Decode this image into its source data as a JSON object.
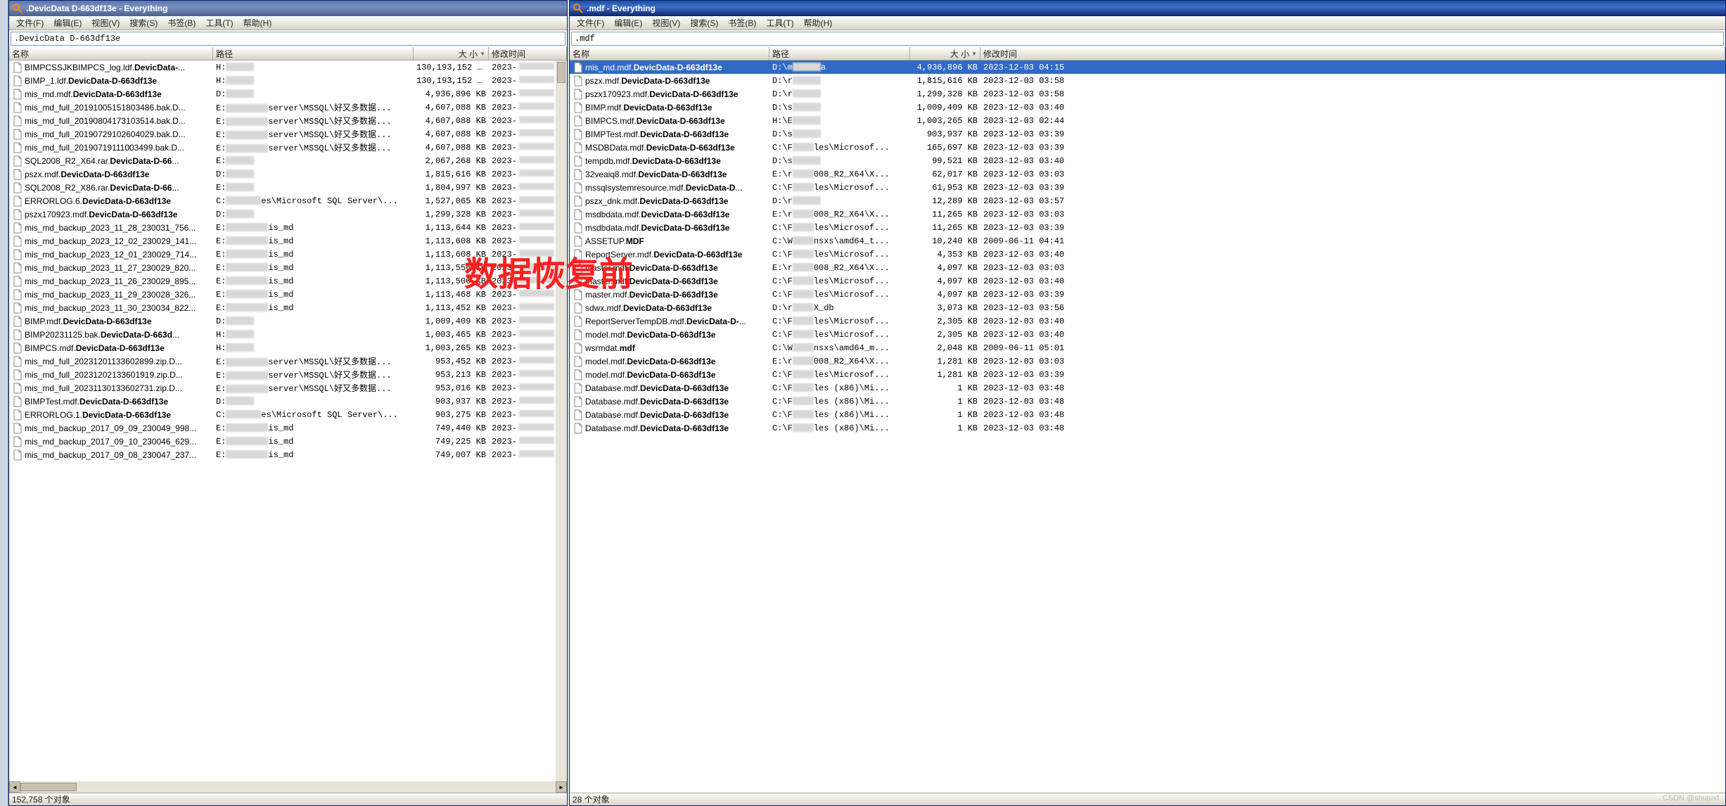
{
  "overlay": "数据恢复前",
  "watermark": "CSDN @shujuxf",
  "windows": [
    {
      "title": ".DevicData D-663df13e - Everything",
      "active": false,
      "menu": [
        "文件(F)",
        "编辑(E)",
        "视图(V)",
        "搜索(S)",
        "书签(B)",
        "工具(T)",
        "帮助(H)"
      ],
      "search": ".DevicData D-663df13e",
      "columns": {
        "name": "名称",
        "path": "路径",
        "size": "大 小",
        "date": "修改时间"
      },
      "status": "152,758 个对象",
      "rows": [
        {
          "name": "BIMPCSSJKBIMPCS_log.ldf.DevicData-...",
          "sel": false,
          "path_pre": "H:",
          "path_mid": 40,
          "path_post": "",
          "size": "130,193,152 KB",
          "date": "2023-"
        },
        {
          "name": "BIMP_1.ldf.DevicData-D-663df13e",
          "sel": false,
          "path_pre": "H:",
          "path_mid": 40,
          "path_post": "",
          "size": "130,193,152 KB",
          "date": "2023-"
        },
        {
          "name": "mis_md.mdf.DevicData-D-663df13e",
          "sel": false,
          "path_pre": "D:",
          "path_mid": 40,
          "path_post": "",
          "size": "4,936,896 KB",
          "date": "2023-"
        },
        {
          "name": "mis_md_full_20191005151803486.bak.D...",
          "sel": false,
          "path_pre": "E:",
          "path_mid": 60,
          "path_post": "server\\MSSQL\\好又多数据...",
          "size": "4,607,088 KB",
          "date": "2023-"
        },
        {
          "name": "mis_md_full_20190804173103514.bak.D...",
          "sel": false,
          "path_pre": "E:",
          "path_mid": 60,
          "path_post": "server\\MSSQL\\好又多数据...",
          "size": "4,607,088 KB",
          "date": "2023-"
        },
        {
          "name": "mis_md_full_20190729102604029.bak.D...",
          "sel": false,
          "path_pre": "E:",
          "path_mid": 60,
          "path_post": "server\\MSSQL\\好又多数据...",
          "size": "4,607,088 KB",
          "date": "2023-"
        },
        {
          "name": "mis_md_full_20190719111003499.bak.D...",
          "sel": false,
          "path_pre": "E:",
          "path_mid": 60,
          "path_post": "server\\MSSQL\\好又多数据...",
          "size": "4,607,088 KB",
          "date": "2023-"
        },
        {
          "name": "SQL2008_R2_X64.rar.DevicData-D-66...",
          "sel": false,
          "path_pre": "E:",
          "path_mid": 40,
          "path_post": "",
          "size": "2,067,268 KB",
          "date": "2023-"
        },
        {
          "name": "pszx.mdf.DevicData-D-663df13e",
          "sel": false,
          "path_pre": "D:",
          "path_mid": 40,
          "path_post": "",
          "size": "1,815,616 KB",
          "date": "2023-"
        },
        {
          "name": "SQL2008_R2_X86.rar.DevicData-D-66...",
          "sel": false,
          "path_pre": "E:",
          "path_mid": 40,
          "path_post": "",
          "size": "1,804,997 KB",
          "date": "2023-"
        },
        {
          "name": "ERRORLOG.6.DevicData-D-663df13e",
          "sel": false,
          "path_pre": "C:",
          "path_mid": 50,
          "path_post": "es\\Microsoft SQL Server\\...",
          "size": "1,527,065 KB",
          "date": "2023-"
        },
        {
          "name": "pszx170923.mdf.DevicData-D-663df13e",
          "sel": false,
          "path_pre": "D:",
          "path_mid": 40,
          "path_post": "",
          "size": "1,299,328 KB",
          "date": "2023-"
        },
        {
          "name": "mis_md_backup_2023_11_28_230031_756...",
          "sel": false,
          "path_pre": "E:",
          "path_mid": 60,
          "path_post": "is_md",
          "size": "1,113,644 KB",
          "date": "2023-"
        },
        {
          "name": "mis_md_backup_2023_12_02_230029_141...",
          "sel": false,
          "path_pre": "E:",
          "path_mid": 60,
          "path_post": "is_md",
          "size": "1,113,608 KB",
          "date": "2023-"
        },
        {
          "name": "mis_md_backup_2023_12_01_230029_714...",
          "sel": false,
          "path_pre": "E:",
          "path_mid": 60,
          "path_post": "is_md",
          "size": "1,113,608 KB",
          "date": "2023-"
        },
        {
          "name": "mis_md_backup_2023_11_27_230029_820...",
          "sel": false,
          "path_pre": "E:",
          "path_mid": 60,
          "path_post": "is_md",
          "size": "1,113,556 KB",
          "date": "2023-"
        },
        {
          "name": "mis_md_backup_2023_11_26_230029_895...",
          "sel": false,
          "path_pre": "E:",
          "path_mid": 60,
          "path_post": "is_md",
          "size": "1,113,500 KB",
          "date": "2023-"
        },
        {
          "name": "mis_md_backup_2023_11_29_230028_326...",
          "sel": false,
          "path_pre": "E:",
          "path_mid": 60,
          "path_post": "is_md",
          "size": "1,113,468 KB",
          "date": "2023-"
        },
        {
          "name": "mis_md_backup_2023_11_30_230034_822...",
          "sel": false,
          "path_pre": "E:",
          "path_mid": 60,
          "path_post": "is_md",
          "size": "1,113,452 KB",
          "date": "2023-"
        },
        {
          "name": "BIMP.mdf.DevicData-D-663df13e",
          "sel": false,
          "path_pre": "D:",
          "path_mid": 40,
          "path_post": "",
          "size": "1,009,409 KB",
          "date": "2023-"
        },
        {
          "name": "BIMP20231125.bak.DevicData-D-663d...",
          "sel": false,
          "path_pre": "H:",
          "path_mid": 40,
          "path_post": "",
          "size": "1,003,465 KB",
          "date": "2023-"
        },
        {
          "name": "BIMPCS.mdf.DevicData-D-663df13e",
          "sel": false,
          "path_pre": "H:",
          "path_mid": 40,
          "path_post": "",
          "size": "1,003,265 KB",
          "date": "2023-"
        },
        {
          "name": "mis_md_full_20231201133602899.zip.D...",
          "sel": false,
          "path_pre": "E:",
          "path_mid": 60,
          "path_post": "server\\MSSQL\\好又多数据...",
          "size": "953,452 KB",
          "date": "2023-"
        },
        {
          "name": "mis_md_full_20231202133601919.zip.D...",
          "sel": false,
          "path_pre": "E:",
          "path_mid": 60,
          "path_post": "server\\MSSQL\\好又多数据...",
          "size": "953,213 KB",
          "date": "2023-"
        },
        {
          "name": "mis_md_full_20231130133602731.zip.D...",
          "sel": false,
          "path_pre": "E:",
          "path_mid": 60,
          "path_post": "server\\MSSQL\\好又多数据...",
          "size": "953,016 KB",
          "date": "2023-"
        },
        {
          "name": "BIMPTest.mdf.DevicData-D-663df13e",
          "sel": false,
          "path_pre": "D:",
          "path_mid": 40,
          "path_post": "",
          "size": "903,937 KB",
          "date": "2023-"
        },
        {
          "name": "ERRORLOG.1.DevicData-D-663df13e",
          "sel": false,
          "path_pre": "C:",
          "path_mid": 50,
          "path_post": "es\\Microsoft SQL Server\\...",
          "size": "903,275 KB",
          "date": "2023-"
        },
        {
          "name": "mis_md_backup_2017_09_09_230049_998...",
          "sel": false,
          "path_pre": "E:",
          "path_mid": 60,
          "path_post": "is_md",
          "size": "749,440 KB",
          "date": "2023-"
        },
        {
          "name": "mis_md_backup_2017_09_10_230046_629...",
          "sel": false,
          "path_pre": "E:",
          "path_mid": 60,
          "path_post": "is_md",
          "size": "749,225 KB",
          "date": "2023-"
        },
        {
          "name": "mis_md_backup_2017_09_08_230047_237...",
          "sel": false,
          "path_pre": "E:",
          "path_mid": 60,
          "path_post": "is_md",
          "size": "749,007 KB",
          "date": "2023-"
        }
      ]
    },
    {
      "title": ".mdf - Everything",
      "active": true,
      "menu": [
        "文件(F)",
        "编辑(E)",
        "视图(V)",
        "搜索(S)",
        "书签(B)",
        "工具(T)",
        "帮助(H)"
      ],
      "search": ".mdf",
      "columns": {
        "name": "名称",
        "path": "路径",
        "size": "大 小",
        "date": "修改时间"
      },
      "status": "28 个对象",
      "rows": [
        {
          "name": "mis_md.mdf.DevicData-D-663df13e",
          "sel": true,
          "path_pre": "D:\\m",
          "path_mid": 40,
          "path_post": "a",
          "size": "4,936,896 KB",
          "date": "2023-12-03 04:15"
        },
        {
          "name": "pszx.mdf.DevicData-D-663df13e",
          "sel": false,
          "path_pre": "D:\\r",
          "path_mid": 40,
          "path_post": "",
          "size": "1,815,616 KB",
          "date": "2023-12-03 03:58"
        },
        {
          "name": "pszx170923.mdf.DevicData-D-663df13e",
          "sel": false,
          "path_pre": "D:\\r",
          "path_mid": 40,
          "path_post": "",
          "size": "1,299,328 KB",
          "date": "2023-12-03 03:58"
        },
        {
          "name": "BIMP.mdf.DevicData-D-663df13e",
          "sel": false,
          "path_pre": "D:\\s",
          "path_mid": 40,
          "path_post": "",
          "size": "1,009,409 KB",
          "date": "2023-12-03 03:40"
        },
        {
          "name": "BIMPCS.mdf.DevicData-D-663df13e",
          "sel": false,
          "path_pre": "H:\\E",
          "path_mid": 40,
          "path_post": "",
          "size": "1,003,265 KB",
          "date": "2023-12-03 02:44"
        },
        {
          "name": "BIMPTest.mdf.DevicData-D-663df13e",
          "sel": false,
          "path_pre": "D:\\s",
          "path_mid": 40,
          "path_post": "",
          "size": "903,937 KB",
          "date": "2023-12-03 03:39"
        },
        {
          "name": "MSDBData.mdf.DevicData-D-663df13e",
          "sel": false,
          "path_pre": "C:\\F",
          "path_mid": 30,
          "path_post": "les\\Microsof...",
          "size": "165,697 KB",
          "date": "2023-12-03 03:39"
        },
        {
          "name": "tempdb.mdf.DevicData-D-663df13e",
          "sel": false,
          "path_pre": "D:\\s",
          "path_mid": 40,
          "path_post": "",
          "size": "99,521 KB",
          "date": "2023-12-03 03:40"
        },
        {
          "name": "32veaiq8.mdf.DevicData-D-663df13e",
          "sel": false,
          "path_pre": "E:\\r",
          "path_mid": 30,
          "path_post": "008_R2_X64\\X...",
          "size": "62,017 KB",
          "date": "2023-12-03 03:03"
        },
        {
          "name": "mssqlsystemresource.mdf.DevicData-D...",
          "sel": false,
          "path_pre": "C:\\F",
          "path_mid": 30,
          "path_post": "les\\Microsof...",
          "size": "61,953 KB",
          "date": "2023-12-03 03:39"
        },
        {
          "name": "pszx_dnk.mdf.DevicData-D-663df13e",
          "sel": false,
          "path_pre": "D:\\r",
          "path_mid": 40,
          "path_post": "",
          "size": "12,289 KB",
          "date": "2023-12-03 03:57"
        },
        {
          "name": "msdbdata.mdf.DevicData-D-663df13e",
          "sel": false,
          "path_pre": "E:\\r",
          "path_mid": 30,
          "path_post": "008_R2_X64\\X...",
          "size": "11,265 KB",
          "date": "2023-12-03 03:03"
        },
        {
          "name": "msdbdata.mdf.DevicData-D-663df13e",
          "sel": false,
          "path_pre": "C:\\F",
          "path_mid": 30,
          "path_post": "les\\Microsof...",
          "size": "11,265 KB",
          "date": "2023-12-03 03:39"
        },
        {
          "name": "ASSETUP.MDF",
          "sel": false,
          "strong": true,
          "path_pre": "C:\\W",
          "path_mid": 30,
          "path_post": "nsxs\\amd64_t...",
          "size": "10,240 KB",
          "date": "2009-06-11 04:41"
        },
        {
          "name": "ReportServer.mdf.DevicData-D-663df13e",
          "sel": false,
          "path_pre": "C:\\F",
          "path_mid": 30,
          "path_post": "les\\Microsof...",
          "size": "4,353 KB",
          "date": "2023-12-03 03:40"
        },
        {
          "name": "master.mdf.DevicData-D-663df13e",
          "sel": false,
          "path_pre": "E:\\r",
          "path_mid": 30,
          "path_post": "008_R2_X64\\X...",
          "size": "4,097 KB",
          "date": "2023-12-03 03:03"
        },
        {
          "name": "master.mdf.DevicData-D-663df13e",
          "sel": false,
          "path_pre": "C:\\F",
          "path_mid": 30,
          "path_post": "les\\Microsof...",
          "size": "4,097 KB",
          "date": "2023-12-03 03:40"
        },
        {
          "name": "master.mdf.DevicData-D-663df13e",
          "sel": false,
          "path_pre": "C:\\F",
          "path_mid": 30,
          "path_post": "les\\Microsof...",
          "size": "4,097 KB",
          "date": "2023-12-03 03:39"
        },
        {
          "name": "sdwx.mdf.DevicData-D-663df13e",
          "sel": false,
          "path_pre": "D:\\r",
          "path_mid": 30,
          "path_post": "X_db",
          "size": "3,073 KB",
          "date": "2023-12-03 03:56"
        },
        {
          "name": "ReportServerTempDB.mdf.DevicData-D-...",
          "sel": false,
          "path_pre": "C:\\F",
          "path_mid": 30,
          "path_post": "les\\Microsof...",
          "size": "2,305 KB",
          "date": "2023-12-03 03:40"
        },
        {
          "name": "model.mdf.DevicData-D-663df13e",
          "sel": false,
          "path_pre": "C:\\F",
          "path_mid": 30,
          "path_post": "les\\Microsof...",
          "size": "2,305 KB",
          "date": "2023-12-03 03:40"
        },
        {
          "name": "wsrmdat.mdf",
          "sel": false,
          "strong": true,
          "path_pre": "C:\\W",
          "path_mid": 30,
          "path_post": "nsxs\\amd64_m...",
          "size": "2,048 KB",
          "date": "2009-06-11 05:01"
        },
        {
          "name": "model.mdf.DevicData-D-663df13e",
          "sel": false,
          "path_pre": "E:\\r",
          "path_mid": 30,
          "path_post": "008_R2_X64\\X...",
          "size": "1,281 KB",
          "date": "2023-12-03 03:03"
        },
        {
          "name": "model.mdf.DevicData-D-663df13e",
          "sel": false,
          "path_pre": "C:\\F",
          "path_mid": 30,
          "path_post": "les\\Microsof...",
          "size": "1,281 KB",
          "date": "2023-12-03 03:39"
        },
        {
          "name": "Database.mdf.DevicData-D-663df13e",
          "sel": false,
          "path_pre": "C:\\F",
          "path_mid": 30,
          "path_post": "les (x86)\\Mi...",
          "size": "1 KB",
          "date": "2023-12-03 03:48"
        },
        {
          "name": "Database.mdf.DevicData-D-663df13e",
          "sel": false,
          "path_pre": "C:\\F",
          "path_mid": 30,
          "path_post": "les (x86)\\Mi...",
          "size": "1 KB",
          "date": "2023-12-03 03:48"
        },
        {
          "name": "Database.mdf.DevicData-D-663df13e",
          "sel": false,
          "path_pre": "C:\\F",
          "path_mid": 30,
          "path_post": "les (x86)\\Mi...",
          "size": "1 KB",
          "date": "2023-12-03 03:48"
        },
        {
          "name": "Database.mdf.DevicData-D-663df13e",
          "sel": false,
          "path_pre": "C:\\F",
          "path_mid": 30,
          "path_post": "les (x86)\\Mi...",
          "size": "1 KB",
          "date": "2023-12-03 03:48"
        }
      ]
    }
  ]
}
